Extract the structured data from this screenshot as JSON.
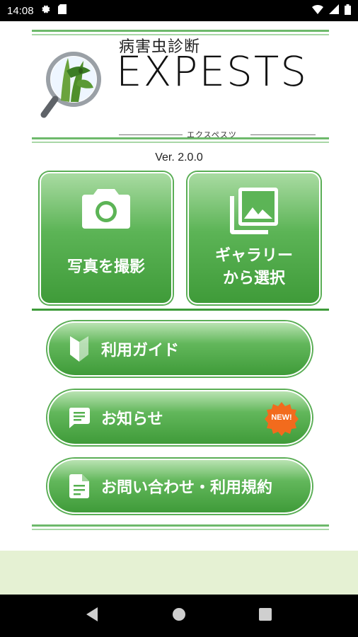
{
  "status_bar": {
    "time": "14:08",
    "icons": [
      "gear-icon",
      "sd-card-icon",
      "wifi-icon",
      "signal-icon",
      "battery-icon"
    ]
  },
  "logo": {
    "title_ja": "病害虫診断",
    "title": "EXPESTS",
    "subtitle": "エクスペスツ"
  },
  "version": "Ver. 2.0.0",
  "tiles": [
    {
      "icon": "camera-icon",
      "label_line1": "写真を撮影",
      "label_line2": ""
    },
    {
      "icon": "gallery-icon",
      "label_line1": "ギャラリー",
      "label_line2": "から選択"
    }
  ],
  "menu": [
    {
      "icon": "beginner-mark-icon",
      "label": "利用ガイド"
    },
    {
      "icon": "message-icon",
      "label": "お知らせ",
      "badge": "NEW!"
    },
    {
      "icon": "document-icon",
      "label": "お問い合わせ・利用規約"
    }
  ],
  "colors": {
    "accent_green": "#4caf50",
    "dark_green": "#3d9b39",
    "badge_orange": "#f26b1d",
    "footer_band": "#e5f1d3"
  },
  "nav": [
    "back-icon",
    "home-icon",
    "recents-icon"
  ]
}
